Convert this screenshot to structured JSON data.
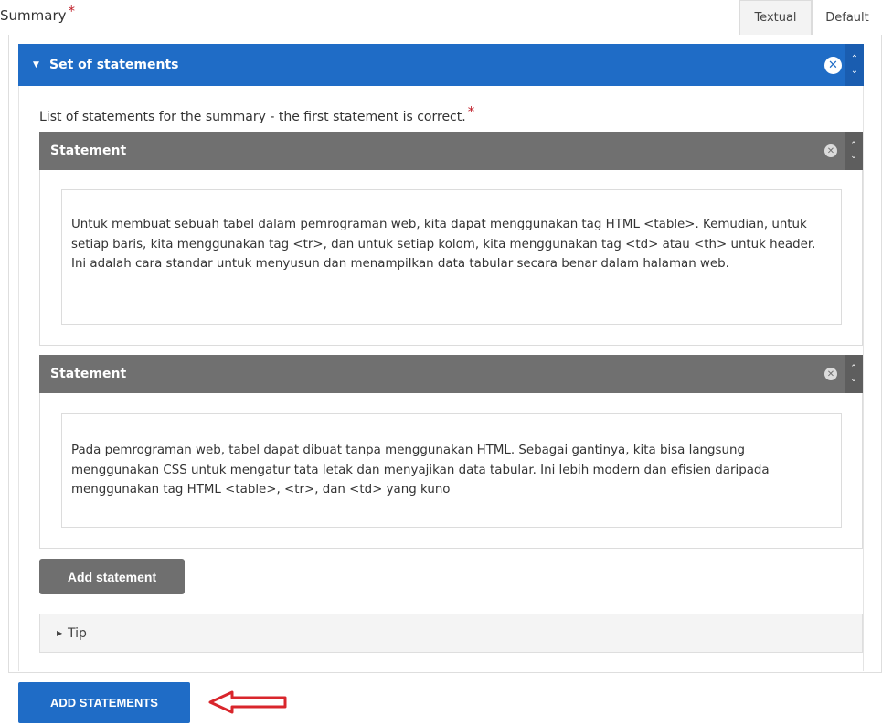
{
  "field": {
    "label": "Summary",
    "required_mark": "*"
  },
  "view_tabs": [
    {
      "label": "Textual"
    },
    {
      "label": "Default"
    }
  ],
  "set": {
    "title": "Set of statements",
    "remove_glyph": "✕",
    "order_up": "⌃",
    "order_down": "⌄",
    "list_label": "List of statements for the summary - the first statement is correct.",
    "required_mark": "*"
  },
  "statements": [
    {
      "title": "Statement",
      "text": "Untuk membuat sebuah tabel dalam pemrograman web, kita dapat menggunakan tag HTML <table>. Kemudian, untuk setiap baris, kita menggunakan tag <tr>, dan untuk setiap kolom, kita menggunakan tag <td> atau <th> untuk header. Ini adalah cara standar untuk menyusun dan menampilkan data tabular secara benar dalam halaman web."
    },
    {
      "title": "Statement",
      "text": "Pada pemrograman web, tabel dapat dibuat tanpa menggunakan HTML. Sebagai gantinya, kita bisa langsung menggunakan CSS untuk mengatur tata letak dan menyajikan data tabular. Ini lebih modern dan efisien daripada menggunakan tag HTML <table>, <tr>, dan <td> yang kuno"
    }
  ],
  "buttons": {
    "add_statement": "Add statement",
    "add_statements": "ADD STATEMENTS"
  },
  "tip": {
    "label": "Tip"
  },
  "colors": {
    "accent": "#1f6cc6",
    "statement_header": "#707070",
    "required": "#c0202a",
    "annotation_arrow": "#d9262c"
  }
}
